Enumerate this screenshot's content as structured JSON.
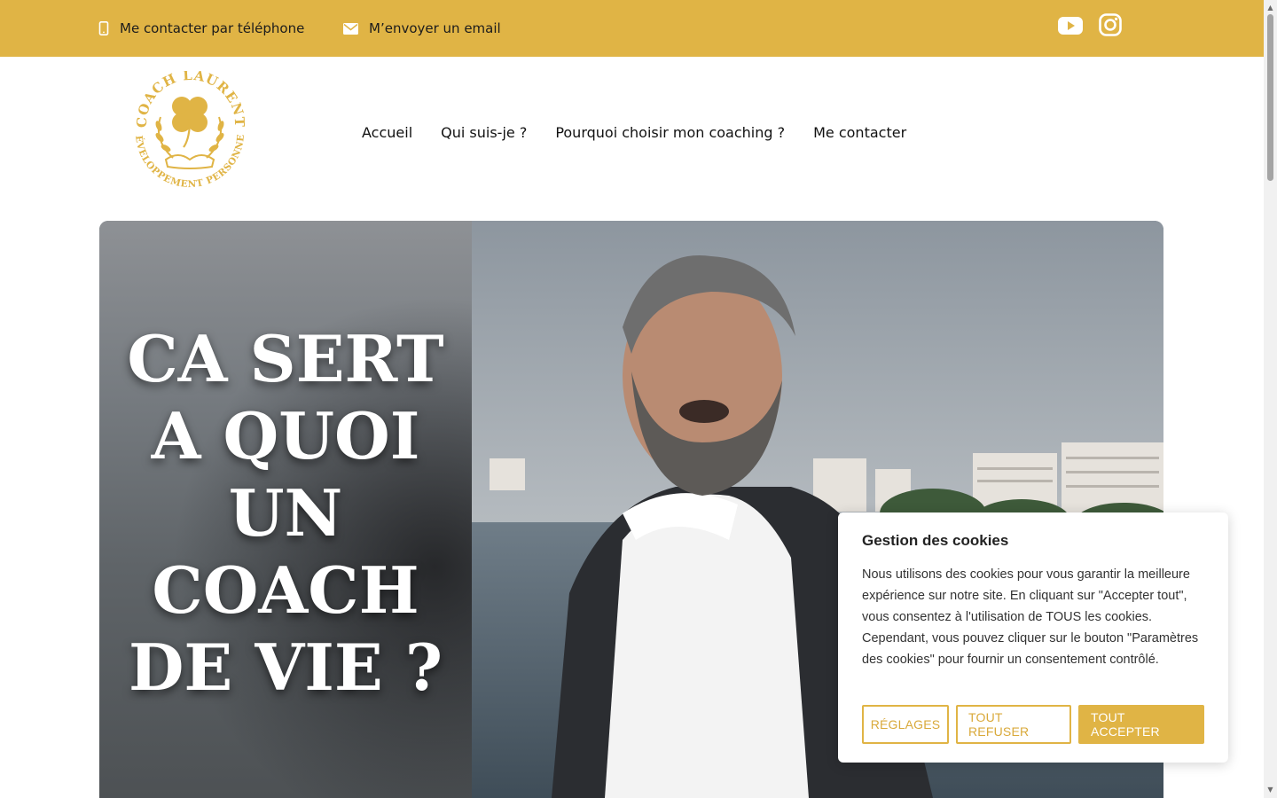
{
  "topbar": {
    "phone_label": "Me contacter par téléphone",
    "email_label": "M’envoyer un email",
    "background": "#e0b445"
  },
  "social": {
    "youtube_icon": "youtube-icon",
    "instagram_icon": "instagram-icon"
  },
  "logo": {
    "top_text": "COACH LAURENT",
    "bottom_text": "DÉVELOPPEMENT PERSONNEL",
    "color": "#e0b445"
  },
  "nav": {
    "items": [
      "Accueil",
      "Qui suis-je ?",
      "Pourquoi choisir mon coaching ?",
      "Me contacter"
    ]
  },
  "hero": {
    "title_lines": [
      "CA SERT",
      "A QUOI",
      "UN",
      "COACH",
      "DE VIE ?"
    ]
  },
  "cookie": {
    "title": "Gestion des cookies",
    "text": "Nous utilisons des cookies pour vous garantir la meilleure expérience sur notre site. En cliquant sur \"Accepter tout\", vous consentez à l'utilisation de TOUS les cookies. Cependant, vous pouvez cliquer sur le bouton \"Paramètres des cookies\" pour fournir un consentement contrôlé.",
    "settings_label": "RÉGLAGES",
    "reject_label": "TOUT REFUSER",
    "accept_label": "TOUT ACCEPTER",
    "accent": "#e0b445"
  }
}
